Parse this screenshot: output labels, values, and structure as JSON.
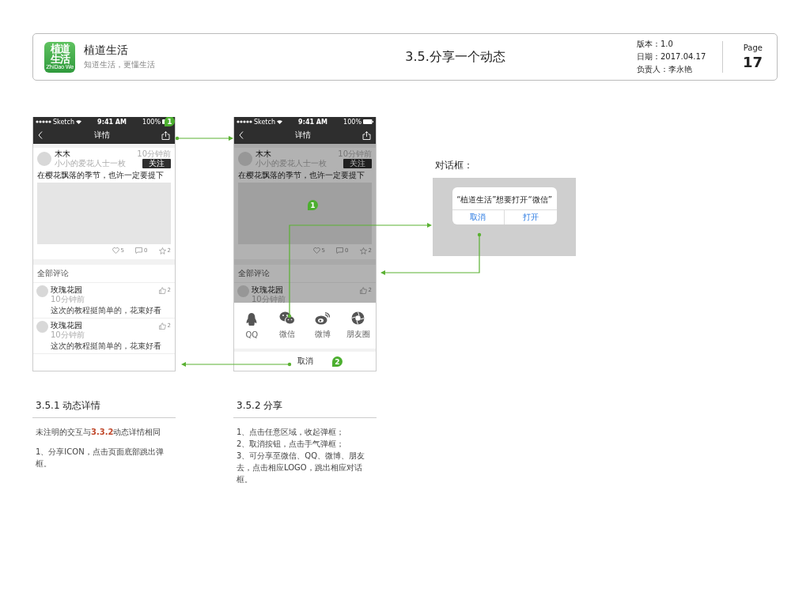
{
  "header": {
    "logo": {
      "line1": "植道",
      "line2": "生活",
      "caption": "ZhiDao We"
    },
    "app_name": "植道生活",
    "tagline": "知道生活，更懂生活",
    "title": "3.5.分享一个动态",
    "meta": [
      "版本：1.0",
      "日期：2017.04.17",
      "负责人：李永艳"
    ],
    "page_label": "Page",
    "page_number": "17"
  },
  "phones": [
    {
      "dimmed": false,
      "status": {
        "carrier": "Sketch",
        "time": "9:41 AM",
        "battery": "100%"
      },
      "nav_title": "详情",
      "share_badge": "1",
      "post": {
        "author": "木木",
        "bio": "小小的爱花人士一枚",
        "time": "10分钟前",
        "follow": "关注",
        "text": "在樱花飘落的季节，也许一定要提下",
        "likes": "5",
        "comments": "0",
        "stars": "2"
      },
      "comments_header": "全部评论",
      "comments": [
        {
          "name": "玫瑰花园",
          "time": "10分钟前",
          "likes": "2",
          "text": "这次的教程挺简单的，花束好看"
        },
        {
          "name": "玫瑰花园",
          "time": "10分钟前",
          "likes": "2",
          "text": "这次的教程挺简单的，花束好看"
        }
      ]
    },
    {
      "dimmed": true,
      "status": {
        "carrier": "Sketch",
        "time": "9:41 AM",
        "battery": "100%"
      },
      "nav_title": "详情",
      "image_badge": "1",
      "post": {
        "author": "木木",
        "bio": "小小的爱花人士一枚",
        "time": "10分钟前",
        "follow": "关注",
        "text": "在樱花飘落的季节，也许一定要提下",
        "likes": "5",
        "comments": "0",
        "stars": "2"
      },
      "comments_header": "全部评论",
      "comments": [
        {
          "name": "玫瑰花园",
          "time": "10分钟前",
          "likes": "2"
        }
      ],
      "share_sheet": {
        "items": [
          {
            "kind": "qq",
            "label": "QQ"
          },
          {
            "kind": "wechat",
            "label": "微信"
          },
          {
            "kind": "weibo",
            "label": "微博"
          },
          {
            "kind": "moments",
            "label": "朋友圈"
          }
        ],
        "cancel": "取消",
        "cancel_badge": "2"
      }
    }
  ],
  "dialog": {
    "label": "对话框：",
    "message": "“植道生活”想要打开“微信”",
    "buttons": [
      "取消",
      "打开"
    ]
  },
  "notes": [
    {
      "title": "3.5.1 动态详情",
      "paragraphs": [
        "未注明的交互与**3.3.2**动态详情相同",
        "1、分享ICON，点击页面底部跳出弹框。"
      ]
    },
    {
      "title": "3.5.2 分享",
      "paragraphs": [
        "1、点击任意区域，收起弹框；",
        "2、取消按钮，点击手气弹框；",
        "3、可分享至微信、QQ、微博、朋友去，点击相应LOGO，跳出相应对话框。"
      ]
    }
  ]
}
